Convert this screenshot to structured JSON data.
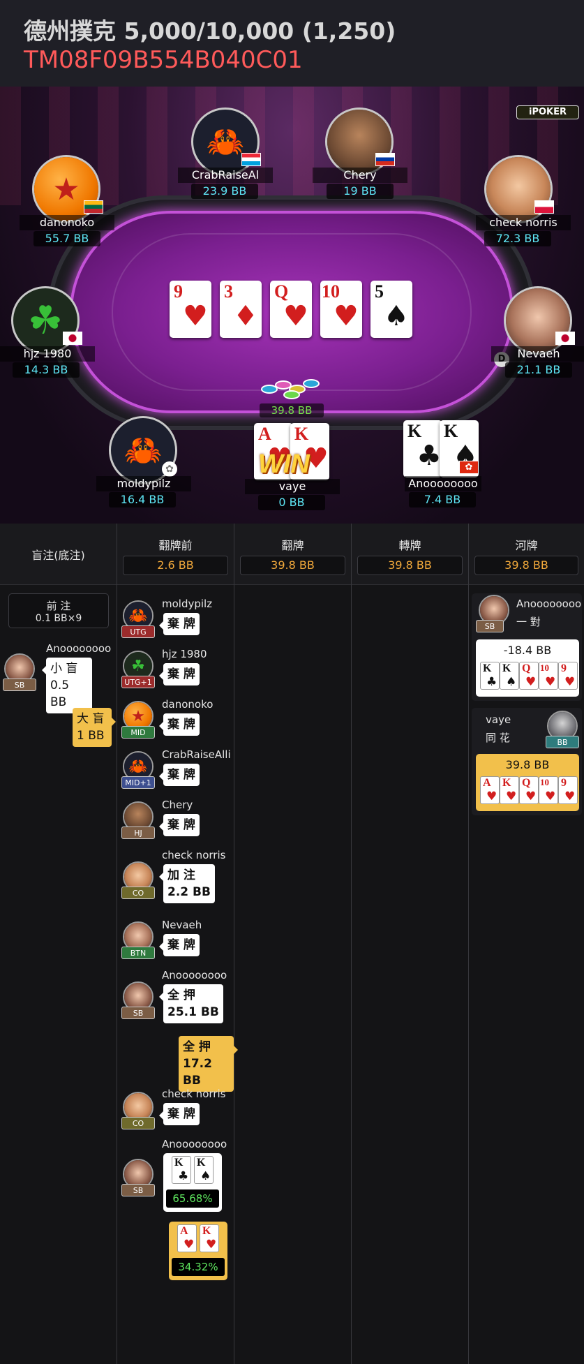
{
  "header": {
    "game_title": "德州撲克 5,000/10,000 (1,250)",
    "hand_id": "TM08F09B554B040C01"
  },
  "table": {
    "logo": "iPOKER",
    "board": [
      {
        "rank": "9",
        "suit": "♥",
        "color": "red"
      },
      {
        "rank": "3",
        "suit": "♦",
        "color": "red"
      },
      {
        "rank": "Q",
        "suit": "♥",
        "color": "red"
      },
      {
        "rank": "10",
        "suit": "♥",
        "color": "red"
      },
      {
        "rank": "5",
        "suit": "♠",
        "color": "black"
      }
    ],
    "pot": "39.8 BB",
    "dealer_button": "D",
    "win_label": "WIN",
    "players": [
      {
        "name": "danonoko",
        "stack": "55.7 BB",
        "avatar": "dragon-ball"
      },
      {
        "name": "CrabRaiseAl",
        "stack": "23.9 BB",
        "avatar": "crab"
      },
      {
        "name": "Chery",
        "stack": "19 BB",
        "avatar": "man"
      },
      {
        "name": "check norris",
        "stack": "72.3 BB",
        "avatar": "glasses-man"
      },
      {
        "name": "hjz 1980",
        "stack": "14.3 BB",
        "avatar": "clover"
      },
      {
        "name": "Nevaeh",
        "stack": "21.1 BB",
        "avatar": "woman"
      },
      {
        "name": "moldypilz",
        "stack": "16.4 BB",
        "avatar": "crab"
      },
      {
        "name": "vaye",
        "stack": "0 BB",
        "avatar": "hidden"
      },
      {
        "name": "Anoooooooo",
        "stack": "7.4 BB",
        "avatar": "hidden"
      }
    ],
    "vaye_cards": [
      {
        "rank": "A",
        "suit": "♥"
      },
      {
        "rank": "K",
        "suit": "♥"
      }
    ],
    "ano_cards": [
      {
        "rank": "K",
        "suit": "♣"
      },
      {
        "rank": "K",
        "suit": "♠"
      }
    ]
  },
  "history": {
    "columns": [
      {
        "label": "盲注(底注)",
        "pot": ""
      },
      {
        "label": "翻牌前",
        "pot": "2.6 BB"
      },
      {
        "label": "翻牌",
        "pot": "39.8 BB"
      },
      {
        "label": "轉牌",
        "pot": "39.8 BB"
      },
      {
        "label": "河牌",
        "pot": "39.8 BB"
      }
    ],
    "blinds": {
      "ante_label": "前 注",
      "ante_value": "0.1 BB×9",
      "sb_name": "Anoooooooo",
      "sb_pos": "SB",
      "sb_action": "小 盲",
      "sb_amount": "0.5 BB",
      "bb_action": "大 盲",
      "bb_amount": "1 BB"
    },
    "preflop": [
      {
        "name": "moldypilz",
        "pos": "UTG",
        "action": "棄 牌",
        "amount": ""
      },
      {
        "name": "hjz 1980",
        "pos": "UTG+1",
        "action": "棄 牌",
        "amount": ""
      },
      {
        "name": "danonoko",
        "pos": "MID",
        "action": "棄 牌",
        "amount": ""
      },
      {
        "name": "CrabRaiseAlli",
        "pos": "MID+1",
        "action": "棄 牌",
        "amount": ""
      },
      {
        "name": "Chery",
        "pos": "HJ",
        "action": "棄 牌",
        "amount": ""
      },
      {
        "name": "check norris",
        "pos": "CO",
        "action": "加 注",
        "amount": "2.2 BB"
      },
      {
        "name": "Nevaeh",
        "pos": "BTN",
        "action": "棄 牌",
        "amount": ""
      },
      {
        "name": "Anoooooooo",
        "pos": "SB",
        "action": "全 押",
        "amount": "25.1 BB"
      }
    ],
    "hero_allin": {
      "action": "全 押",
      "amount": "17.2 BB"
    },
    "preflop2": [
      {
        "name": "check norris",
        "pos": "CO",
        "action": "棄 牌"
      }
    ],
    "showdown": {
      "ano_name": "Anoooooooo",
      "ano_pos": "SB",
      "ano_equity": "65.68%",
      "hero_equity": "34.32%"
    },
    "river": {
      "loser_name": "Anoooooooo",
      "loser_pos": "SB",
      "loser_hand": "一 對",
      "loser_result": "-18.4 BB",
      "loser_cards": [
        {
          "rank": "K",
          "suit": "♣",
          "color": "black"
        },
        {
          "rank": "K",
          "suit": "♠",
          "color": "black"
        },
        {
          "rank": "Q",
          "suit": "♥",
          "color": "red"
        },
        {
          "rank": "10",
          "suit": "♥",
          "color": "red"
        },
        {
          "rank": "9",
          "suit": "♥",
          "color": "red"
        }
      ],
      "winner_name": "vaye",
      "winner_pos": "BB",
      "winner_hand": "同 花",
      "winner_result": "39.8 BB",
      "winner_cards": [
        {
          "rank": "A",
          "suit": "♥",
          "color": "red"
        },
        {
          "rank": "K",
          "suit": "♥",
          "color": "red"
        },
        {
          "rank": "Q",
          "suit": "♥",
          "color": "red"
        },
        {
          "rank": "10",
          "suit": "♥",
          "color": "red"
        },
        {
          "rank": "9",
          "suit": "♥",
          "color": "red"
        }
      ]
    }
  },
  "colors": {
    "accent": "#f2a93b",
    "stack": "#5ee6f5",
    "handid": "#ff5a5a",
    "equity": "#5ee65e"
  }
}
